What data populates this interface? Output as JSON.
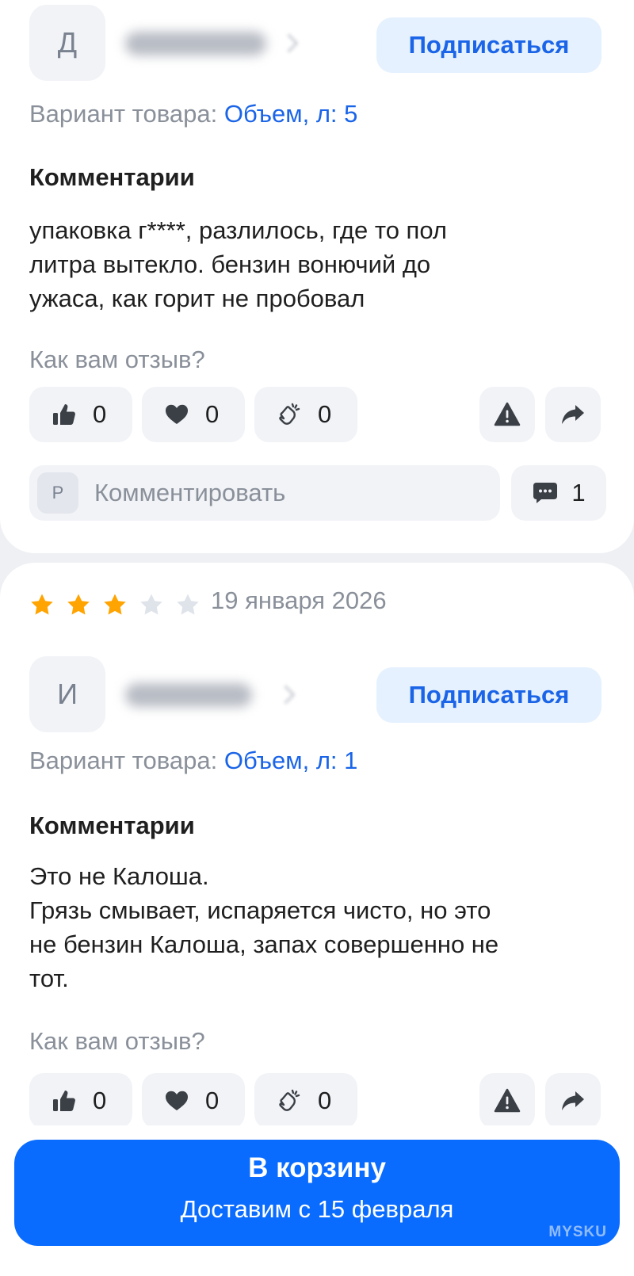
{
  "reviews": [
    {
      "avatar_letter": "Д",
      "subscribe_label": "Подписаться",
      "variant_label": "Вариант товара:",
      "variant_value": "Объем, л: 5",
      "comments_title": "Комментарии",
      "comment_text": "упаковка г****, разлилось, где то пол\nлитра вытекло. бензин вонючий до\nужаса, как горит не пробовал",
      "how_label": "Как вам отзыв?",
      "likes": "0",
      "hearts": "0",
      "claps": "0",
      "comment_placeholder": "Комментировать",
      "commenter_letter": "Р",
      "comments_count": "1"
    },
    {
      "rating": 3,
      "rating_max": 5,
      "date": "19 января 2026",
      "avatar_letter": "И",
      "subscribe_label": "Подписаться",
      "variant_label": "Вариант товара:",
      "variant_value": "Объем, л: 1",
      "comments_title": "Комментарии",
      "comment_text": "Это не Калоша.\nГрязь смывает, испаряется чисто, но это\nне бензин Калоша, запах совершенно не\nтот.",
      "how_label": "Как вам отзыв?",
      "likes": "0",
      "hearts": "0",
      "claps": "0"
    }
  ],
  "cart": {
    "title": "В корзину",
    "subtitle": "Доставим с 15 февраля"
  },
  "watermark": "MYSKU",
  "colors": {
    "accent": "#0a6cff",
    "link": "#1a64e8",
    "star_filled": "#ffa400",
    "star_empty": "#dfe3ea",
    "chip_bg": "#f1f3f7",
    "subscribe_bg": "#e5f1ff"
  }
}
